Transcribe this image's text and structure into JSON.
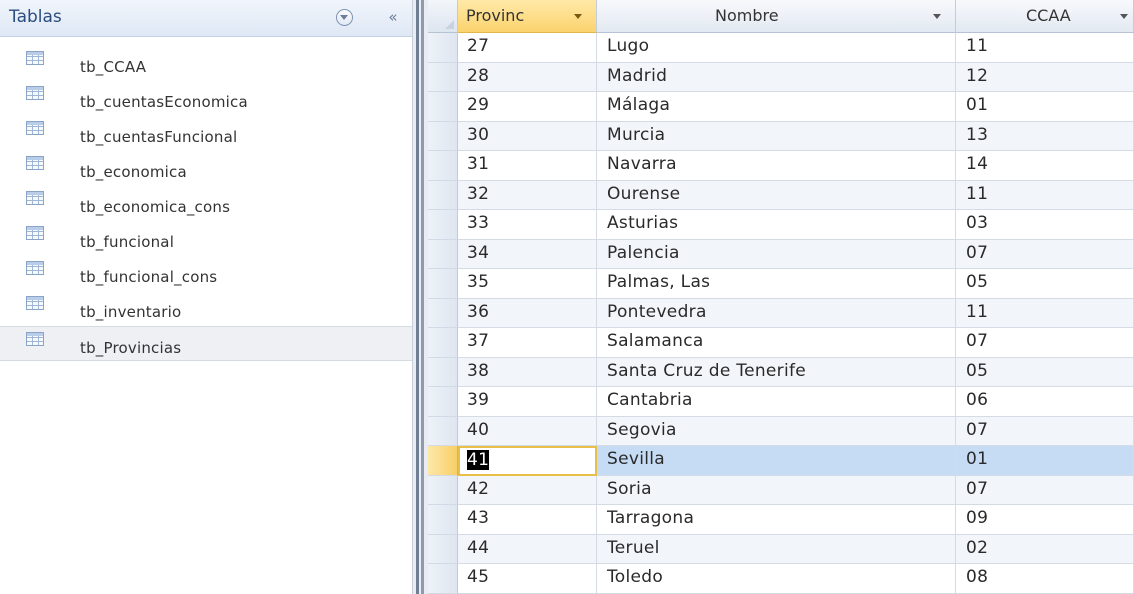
{
  "nav": {
    "title": "Tablas",
    "menu_icon": "chevron-down-circle-icon",
    "collapse_label": "«",
    "items": [
      {
        "label": "tb_CCAA",
        "icon": "table-icon"
      },
      {
        "label": "tb_cuentasEconomica",
        "icon": "table-icon"
      },
      {
        "label": "tb_cuentasFuncional",
        "icon": "table-icon"
      },
      {
        "label": "tb_economica",
        "icon": "table-icon"
      },
      {
        "label": "tb_economica_cons",
        "icon": "table-icon"
      },
      {
        "label": "tb_funcional",
        "icon": "table-icon"
      },
      {
        "label": "tb_funcional_cons",
        "icon": "table-icon"
      },
      {
        "label": "tb_inventario",
        "icon": "table-icon"
      },
      {
        "label": "tb_Provincias",
        "icon": "table-icon",
        "selected": true
      }
    ]
  },
  "datasheet": {
    "columns": [
      {
        "label": "Provinc"
      },
      {
        "label": "Nombre"
      },
      {
        "label": "CCAA"
      }
    ],
    "current_row": 14,
    "rows": [
      [
        "27",
        "Lugo",
        "11"
      ],
      [
        "28",
        "Madrid",
        "12"
      ],
      [
        "29",
        "Málaga",
        "01"
      ],
      [
        "30",
        "Murcia",
        "13"
      ],
      [
        "31",
        "Navarra",
        "14"
      ],
      [
        "32",
        "Ourense",
        "11"
      ],
      [
        "33",
        "Asturias",
        "03"
      ],
      [
        "34",
        "Palencia",
        "07"
      ],
      [
        "35",
        "Palmas, Las",
        "05"
      ],
      [
        "36",
        "Pontevedra",
        "11"
      ],
      [
        "37",
        "Salamanca",
        "07"
      ],
      [
        "38",
        "Santa Cruz de Tenerife",
        "05"
      ],
      [
        "39",
        "Cantabria",
        "06"
      ],
      [
        "40",
        "Segovia",
        "07"
      ],
      [
        "41",
        "Sevilla",
        "01"
      ],
      [
        "42",
        "Soria",
        "07"
      ],
      [
        "43",
        "Tarragona",
        "09"
      ],
      [
        "44",
        "Teruel",
        "02"
      ],
      [
        "45",
        "Toledo",
        "08"
      ]
    ]
  },
  "colors": {
    "accent": "#fbd36e",
    "selection": "#c6dcf5",
    "nav_title": "#2a4c7f"
  }
}
